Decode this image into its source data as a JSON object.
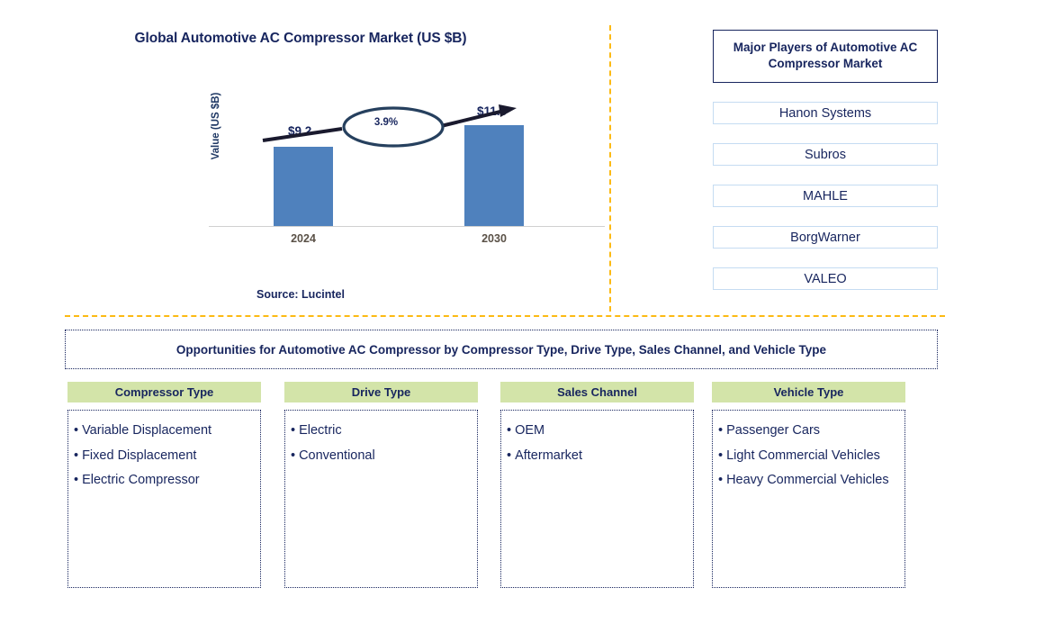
{
  "chart_panel": {
    "title": "Global Automotive AC Compressor Market (US $B)",
    "y_axis_label": "Value (US $B)",
    "source": "Source: Lucintel",
    "bar_color": "#4F81BD",
    "label_color": "#17255E"
  },
  "chart_data": {
    "type": "bar",
    "title": "Global Automotive AC Compressor Market (US $B)",
    "xlabel": "",
    "ylabel": "Value (US $B)",
    "categories": [
      "2024",
      "2030"
    ],
    "values": [
      9.2,
      11.6
    ],
    "value_labels": [
      "$9.2",
      "$11.6"
    ],
    "cagr": "3.9%",
    "cagr_annotation": "3.9%",
    "ylim": [
      0,
      13
    ],
    "grid": false,
    "legend": "none",
    "source": "Source: Lucintel"
  },
  "players": {
    "header": "Major Players of Automotive AC Compressor Market",
    "items": [
      {
        "name": "Hanon Systems"
      },
      {
        "name": "Subros"
      },
      {
        "name": "MAHLE"
      },
      {
        "name": "BorgWarner"
      },
      {
        "name": "VALEO"
      }
    ]
  },
  "opportunities": {
    "banner": "Opportunities for Automotive AC Compressor by Compressor Type, Drive Type, Sales Channel, and Vehicle Type",
    "header_bg": "#D3E4A9",
    "columns": [
      {
        "header": "Compressor Type",
        "items": [
          "Variable Displacement",
          "Fixed Displacement",
          "Electric Compressor"
        ]
      },
      {
        "header": "Drive Type",
        "items": [
          "Electric",
          "Conventional"
        ]
      },
      {
        "header": "Sales Channel",
        "items": [
          "OEM",
          "Aftermarket"
        ]
      },
      {
        "header": "Vehicle Type",
        "items": [
          "Passenger Cars",
          "Light Commercial Vehicles",
          "Heavy Commercial Vehicles"
        ]
      }
    ]
  },
  "dividers": {
    "color": "#FCBA14"
  }
}
